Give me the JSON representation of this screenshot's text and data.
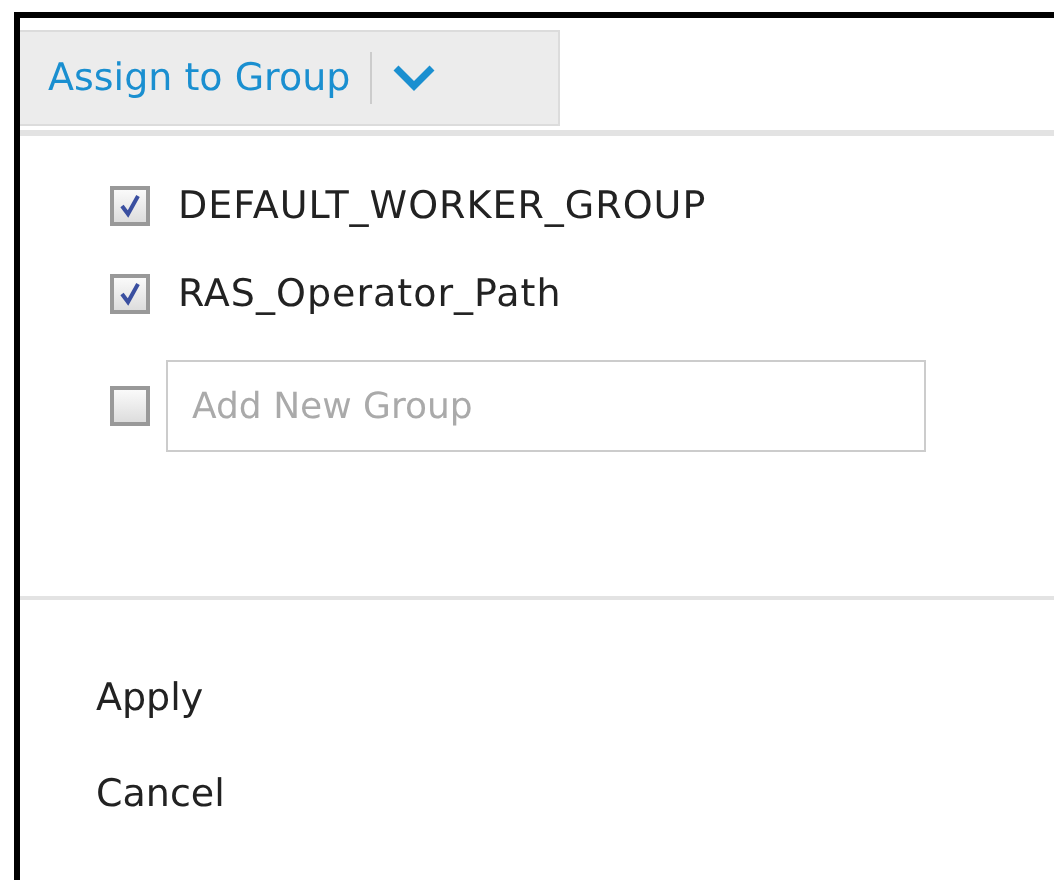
{
  "button": {
    "label": "Assign to Group"
  },
  "groups": [
    {
      "label": "DEFAULT_WORKER_GROUP",
      "checked": true
    },
    {
      "label": "RAS_Operator_Path",
      "checked": true
    }
  ],
  "new_group": {
    "checked": false,
    "placeholder": "Add New Group"
  },
  "actions": [
    "Apply",
    "Cancel"
  ]
}
